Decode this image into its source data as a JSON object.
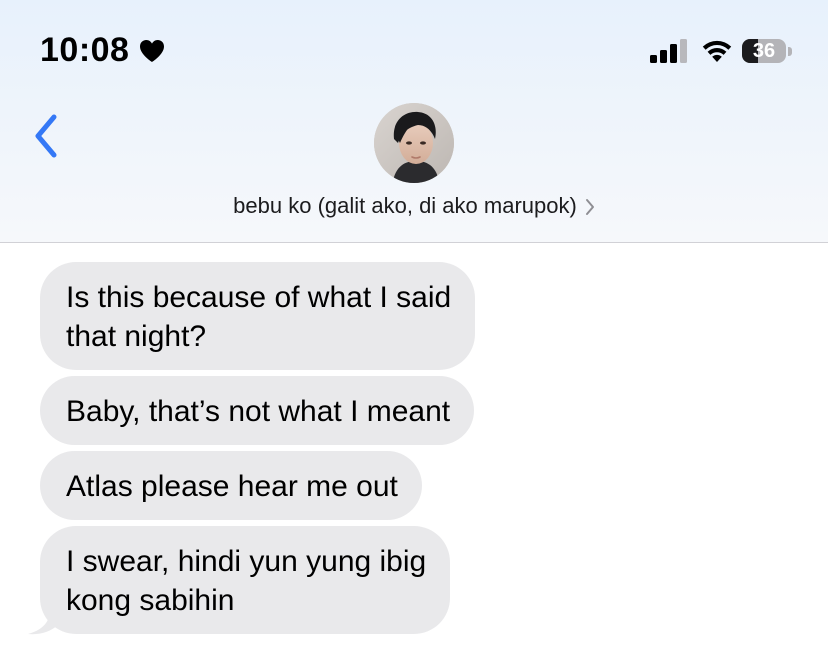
{
  "status_bar": {
    "time": "10:08",
    "battery_level": "36",
    "battery_fraction": 0.36,
    "icons": [
      "heart-icon",
      "signal-icon",
      "wifi-icon",
      "battery-icon"
    ]
  },
  "header": {
    "back_icon": "chevron-left-icon",
    "contact_name": "bebu ko (galit ako, di ako marupok)",
    "accent_color": "#3478f6"
  },
  "messages": [
    {
      "direction": "received",
      "lines": [
        "Is this because of what I said",
        "that night?"
      ]
    },
    {
      "direction": "received",
      "lines": [
        "Baby, that’s not what I meant"
      ]
    },
    {
      "direction": "received",
      "lines": [
        "Atlas please hear me out"
      ]
    },
    {
      "direction": "received",
      "lines": [
        "I swear, hindi yun yung ibig",
        "kong sabihin"
      ]
    }
  ],
  "colors": {
    "received_bubble": "#e9e9eb",
    "text": "#000000"
  }
}
